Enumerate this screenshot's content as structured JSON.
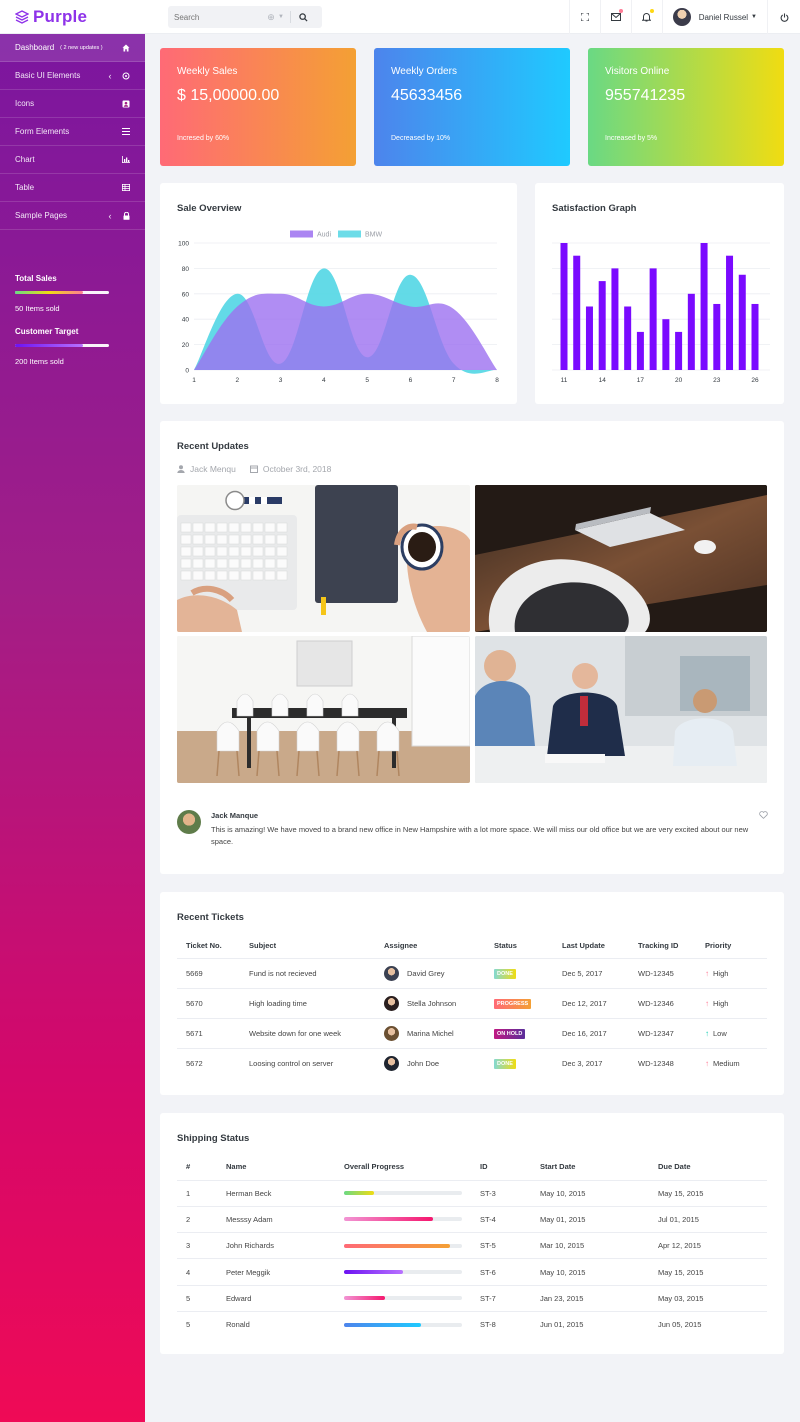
{
  "brand": {
    "name": "Purple",
    "color": "#8e32e9"
  },
  "search": {
    "placeholder": "Search"
  },
  "header": {
    "user_name": "Daniel Russel",
    "icons": [
      "fullscreen-icon",
      "mail-icon",
      "bell-icon",
      "power-icon"
    ],
    "dot_colors": [
      "#fe7c96",
      "#fed713"
    ]
  },
  "sidebar": {
    "items": [
      {
        "label": "Dashboard",
        "badge": "( 2 new updates )",
        "icon": "home-icon",
        "active": true
      },
      {
        "label": "Basic UI Elements",
        "icon": "crosshairs-icon",
        "chevron": "‹"
      },
      {
        "label": "Icons",
        "icon": "contacts-icon"
      },
      {
        "label": "Form Elements",
        "icon": "format-list-icon"
      },
      {
        "label": "Chart",
        "icon": "chart-bar-icon"
      },
      {
        "label": "Table",
        "icon": "table-icon"
      },
      {
        "label": "Sample Pages",
        "icon": "lock-icon",
        "chevron": "‹"
      }
    ],
    "stats": [
      {
        "title": "Total Sales",
        "sub": "50 Items sold",
        "progress": 0.72
      },
      {
        "title": "Customer Target",
        "sub": "200 Items sold",
        "progress": 0.72
      }
    ]
  },
  "stat_cards": [
    {
      "title": "Weekly Sales",
      "value": "$ 15,00000.00",
      "sub": "Incresed by 60%",
      "colors": [
        "#ff6a76",
        "#f4a034"
      ]
    },
    {
      "title": "Weekly Orders",
      "value": "45633456",
      "sub": "Decreased by 10%",
      "colors": [
        "#4d84ec",
        "#1fcaff"
      ]
    },
    {
      "title": "Visitors Online",
      "value": "955741235",
      "sub": "Increased by 5%",
      "colors": [
        "#6ad984",
        "#f0dc12"
      ]
    }
  ],
  "sale_overview": {
    "title": "Sale Overview",
    "legend": [
      "Audi",
      "BMW"
    ]
  },
  "satisfaction": {
    "title": "Satisfaction Graph"
  },
  "chart_data": [
    {
      "type": "area",
      "x": [
        1,
        2,
        3,
        4,
        5,
        6,
        7,
        8
      ],
      "ylim": [
        0,
        100
      ],
      "yticks": [
        0,
        20,
        40,
        60,
        80,
        100
      ],
      "grid": true,
      "legend": "top-center",
      "series": [
        {
          "name": "Audi",
          "color": "#9c70f0",
          "x": [
            1,
            2,
            3,
            4,
            5,
            6,
            7,
            8
          ],
          "values": [
            0,
            50,
            60,
            50,
            60,
            50,
            48,
            0
          ]
        },
        {
          "name": "BMW",
          "color": "#52d6e4",
          "x": [
            1,
            2,
            3,
            4,
            5,
            6,
            7,
            8
          ],
          "values": [
            0,
            60,
            5,
            80,
            10,
            75,
            5,
            0
          ]
        }
      ]
    },
    {
      "type": "bar",
      "x": [
        11,
        12,
        13,
        14,
        15,
        16,
        17,
        18,
        19,
        20,
        21,
        22,
        23,
        24,
        25,
        26
      ],
      "xticks": [
        11,
        14,
        17,
        20,
        23,
        26
      ],
      "values": [
        100,
        90,
        50,
        70,
        80,
        50,
        30,
        80,
        40,
        30,
        60,
        100,
        52,
        90,
        75,
        52
      ],
      "ylim": [
        0,
        100
      ],
      "grid": true,
      "color": "#7a0aff"
    }
  ],
  "recent_updates": {
    "title": "Recent Updates",
    "author": "Jack Menqu",
    "date": "October 3rd, 2018",
    "comment_name": "Jack Manque",
    "comment_text": "This is amazing! We have moved to a brand new office in New Hampshire with a lot more space. We will miss our old office but we are very excited about our new space."
  },
  "tickets": {
    "title": "Recent Tickets",
    "headers": [
      "Ticket No.",
      "Subject",
      "Assignee",
      "Status",
      "Last Update",
      "Tracking ID",
      "Priority"
    ],
    "rows": [
      {
        "no": "5669",
        "subject": "Fund is not recieved",
        "assignee": "David Grey",
        "status": "DONE",
        "status_colors": [
          "#84d9d2",
          "#f0dc12"
        ],
        "date": "Dec 5, 2017",
        "tracking": "WD-12345",
        "priority": "High",
        "arrow": "↑",
        "arrow_color": "#fe7c96"
      },
      {
        "no": "5670",
        "subject": "High loading time",
        "assignee": "Stella Johnson",
        "status": "PROGRESS",
        "status_colors": [
          "#ff6a76",
          "#f4a034"
        ],
        "date": "Dec 12, 2017",
        "tracking": "WD-12346",
        "priority": "High",
        "arrow": "↑",
        "arrow_color": "#fe7c96"
      },
      {
        "no": "5671",
        "subject": "Website down for one week",
        "assignee": "Marina Michel",
        "status": "ON HOLD",
        "status_colors": [
          "#c01a83",
          "#5a2e9a"
        ],
        "date": "Dec 16, 2017",
        "tracking": "WD-12347",
        "priority": "Low",
        "arrow": "↑",
        "arrow_color": "#1bcfb4"
      },
      {
        "no": "5672",
        "subject": "Loosing control on server",
        "assignee": "John Doe",
        "status": "DONE",
        "status_colors": [
          "#84d9d2",
          "#f0dc12"
        ],
        "date": "Dec 3, 2017",
        "tracking": "WD-12348",
        "priority": "Medium",
        "arrow": "↑",
        "arrow_color": "#fe7c96"
      }
    ]
  },
  "shipping": {
    "title": "Shipping Status",
    "headers": [
      "#",
      "Name",
      "Overall Progress",
      "ID",
      "Start Date",
      "Due Date"
    ],
    "rows": [
      {
        "n": "1",
        "name": "Herman Beck",
        "progress": 0.25,
        "colors": [
          "#6ad984",
          "#f0dc12"
        ],
        "id": "ST-3",
        "start": "May 10, 2015",
        "due": "May 15, 2015"
      },
      {
        "n": "2",
        "name": "Messsy Adam",
        "progress": 0.75,
        "colors": [
          "#f295d4",
          "#f5176e"
        ],
        "id": "ST-4",
        "start": "May 01, 2015",
        "due": "Jul 01, 2015"
      },
      {
        "n": "3",
        "name": "John Richards",
        "progress": 0.9,
        "colors": [
          "#ff6a76",
          "#f4a034"
        ],
        "id": "ST-5",
        "start": "Mar 10, 2015",
        "due": "Apr 12, 2015"
      },
      {
        "n": "4",
        "name": "Peter Meggik",
        "progress": 0.5,
        "colors": [
          "#6c12f2",
          "#b872ff"
        ],
        "id": "ST-6",
        "start": "May 10, 2015",
        "due": "May 15, 2015"
      },
      {
        "n": "5",
        "name": "Edward",
        "progress": 0.35,
        "colors": [
          "#f295d4",
          "#f5176e"
        ],
        "id": "ST-7",
        "start": "Jan 23, 2015",
        "due": "May 03, 2015"
      },
      {
        "n": "5",
        "name": "Ronald",
        "progress": 0.65,
        "colors": [
          "#4d84ec",
          "#1fcaff"
        ],
        "id": "ST-8",
        "start": "Jun 01, 2015",
        "due": "Jun 05, 2015"
      }
    ]
  }
}
